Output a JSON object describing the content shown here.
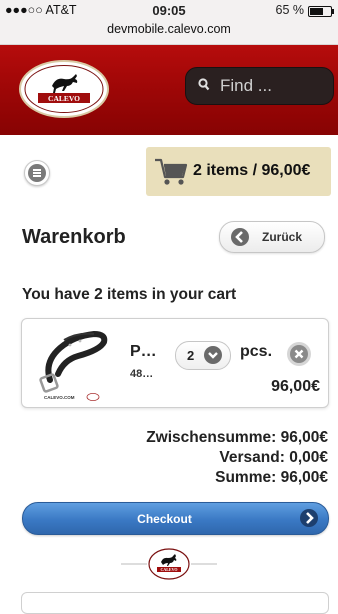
{
  "status_bar": {
    "carrier": "●●●○○ AT&T",
    "time": "09:05",
    "battery_text": "65 %",
    "battery_level": 0.65,
    "url": "devmobile.calevo.com"
  },
  "header": {
    "logo_text": "CALEVO",
    "search_placeholder": "Find ..."
  },
  "toolbar": {
    "cart_summary": "2 items / 96,00€"
  },
  "page": {
    "title": "Warenkorb",
    "back_label": "Zurück",
    "items_text": "You have 2 items in your cart"
  },
  "cart_item": {
    "name": "P…",
    "sku": "48…",
    "quantity": "2",
    "unit": "pcs.",
    "price": "96,00€",
    "image_caption": "CALEVO.COM"
  },
  "totals": {
    "subtotal": "Zwischensumme: 96,00€",
    "shipping": "Versand: 0,00€",
    "total": "Summe: 96,00€"
  },
  "checkout": {
    "label": "Checkout"
  },
  "footer": {
    "logo_text": "CALEVO"
  },
  "colors": {
    "header_red": "#9b0606",
    "cart_box": "#e9dfbb",
    "checkout_blue": "#3a79c4"
  }
}
